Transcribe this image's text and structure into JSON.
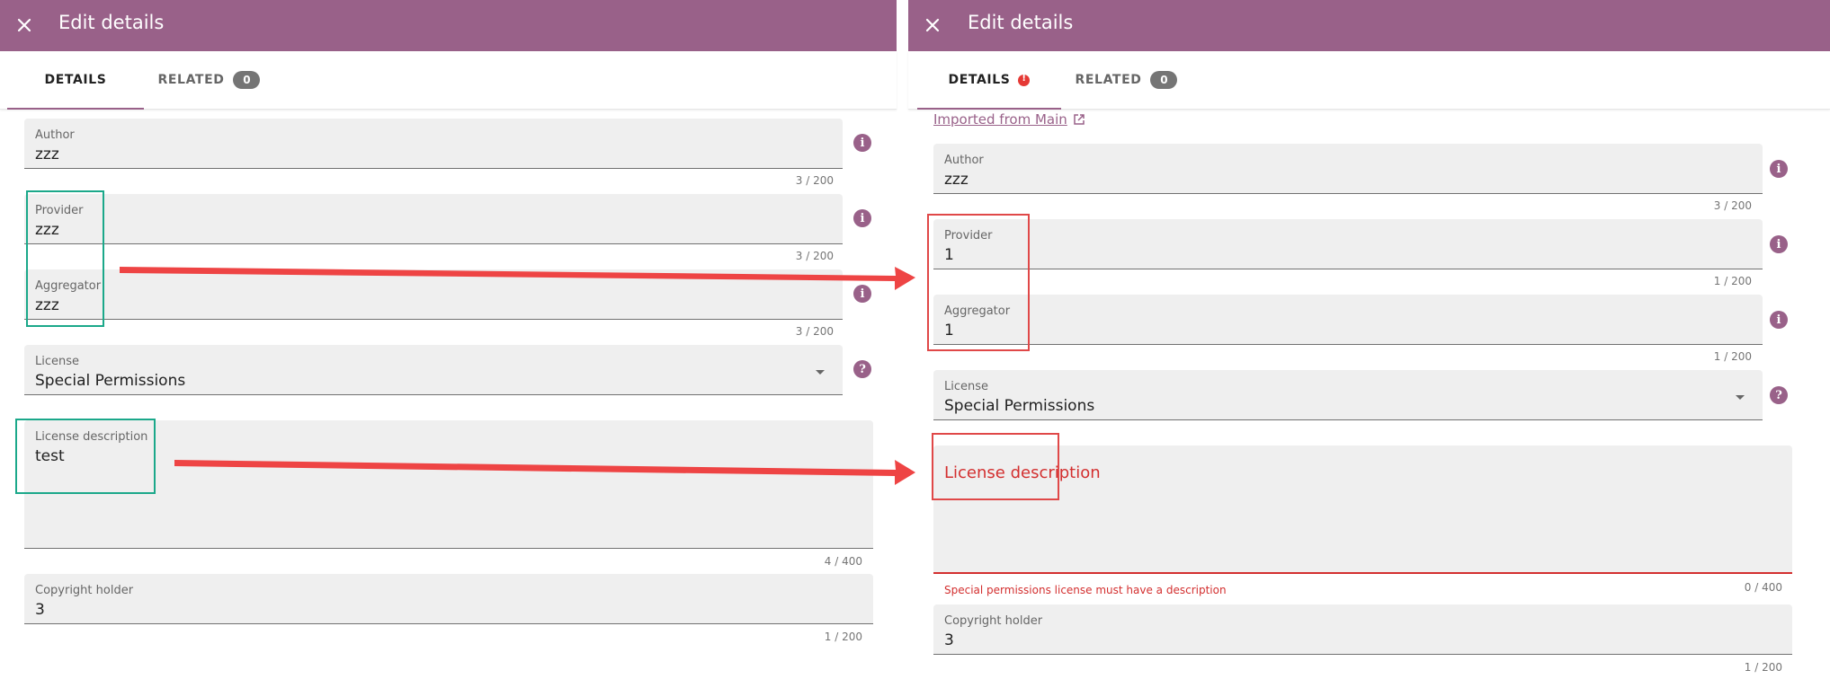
{
  "left": {
    "title": "Edit details",
    "tabs": [
      {
        "label": "DETAILS"
      },
      {
        "label": "RELATED",
        "badge": "0"
      }
    ],
    "fields": {
      "author": {
        "label": "Author",
        "value": "zzz",
        "counter": "3 / 200"
      },
      "provider": {
        "label": "Provider",
        "value": "zzz",
        "counter": "3 / 200"
      },
      "aggregator": {
        "label": "Aggregator",
        "value": "zzz",
        "counter": "3 / 200"
      },
      "license": {
        "label": "License",
        "value": "Special Permissions"
      },
      "license_description": {
        "label": "License description",
        "value": "test",
        "counter": "4 / 400"
      },
      "copyright_holder": {
        "label": "Copyright holder",
        "value": "3",
        "counter": "1 / 200"
      }
    }
  },
  "right": {
    "title": "Edit details",
    "tabs": [
      {
        "label": "DETAILS"
      },
      {
        "label": "RELATED",
        "badge": "0"
      }
    ],
    "imported_link": "Imported from Main",
    "fields": {
      "author": {
        "label": "Author",
        "value": "zzz",
        "counter": "3 / 200"
      },
      "provider": {
        "label": "Provider",
        "value": "1",
        "counter": "1 / 200"
      },
      "aggregator": {
        "label": "Aggregator",
        "value": "1",
        "counter": "1 / 200"
      },
      "license": {
        "label": "License",
        "value": "Special Permissions"
      },
      "license_description": {
        "label": "License description",
        "value": "",
        "counter": "0 / 400",
        "error": "Special permissions license must have a description"
      },
      "copyright_holder": {
        "label": "Copyright holder",
        "value": "3",
        "counter": "1 / 200"
      }
    }
  },
  "icons": {
    "info": "i",
    "help": "?"
  },
  "colors": {
    "appbar": "#996189",
    "error": "#d32f2f",
    "annotation_teal": "#1ba88a",
    "annotation_red": "#e04848"
  }
}
